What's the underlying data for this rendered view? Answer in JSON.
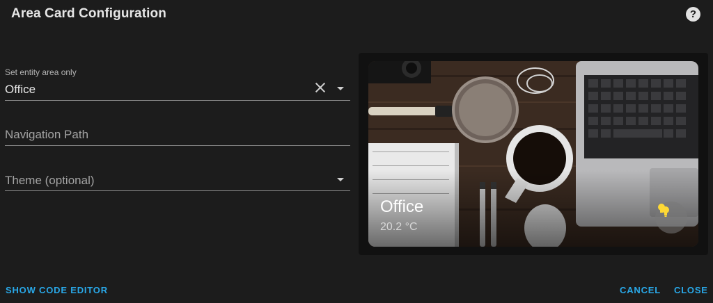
{
  "dialog": {
    "title": "Area Card Configuration",
    "help_symbol": "?"
  },
  "form": {
    "area": {
      "label": "Set entity area only",
      "value": "Office"
    },
    "navigation_path": {
      "placeholder": "Navigation Path",
      "value": ""
    },
    "theme": {
      "placeholder": "Theme (optional)",
      "value": ""
    }
  },
  "preview": {
    "area_name": "Office",
    "temperature": "20.2 °C",
    "light_icon": "lightbulb-group-icon",
    "light_color": "#fdd835"
  },
  "footer": {
    "show_code_editor": "SHOW CODE EDITOR",
    "cancel": "CANCEL",
    "close": "CLOSE"
  },
  "colors": {
    "accent": "#29a8e8",
    "background": "#1c1c1c"
  }
}
